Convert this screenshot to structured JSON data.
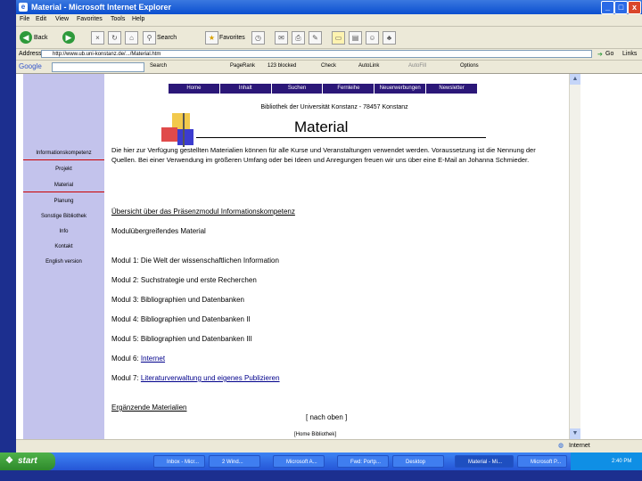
{
  "window": {
    "title": "Material - Microsoft Internet Explorer",
    "minimize": "_",
    "maximize": "□",
    "close": "x"
  },
  "menu": [
    "File",
    "Edit",
    "View",
    "Favorites",
    "Tools",
    "Help"
  ],
  "toolbar": {
    "back": "Back",
    "search": "Search",
    "favorites": "Favorites"
  },
  "address": {
    "label": "Address",
    "url": "http://www.ub.uni-konstanz.de/.../Material.htm",
    "go": "Go",
    "links": "Links"
  },
  "googlebar": {
    "label": "Google",
    "search": "Search",
    "pagerank": "PageRank",
    "blocked": "123 blocked",
    "check": "Check",
    "autolink": "AutoLink",
    "autofill": "AutoFill",
    "options": "Options"
  },
  "sidebar": [
    "Informationskompetenz",
    "Projekt",
    "Material",
    "Planung",
    "Sonstige Bibliothek",
    "Info",
    "Kontakt",
    "English version"
  ],
  "topnav": [
    "Home",
    "Inhalt",
    "Suchen",
    "Fernleihe",
    "Neuerwerbungen",
    "Newsletter"
  ],
  "page": {
    "subtitle": "Bibliothek der Universität Konstanz - 78457 Konstanz",
    "title": "Material",
    "intro": "Die hier zur Verfügung gestellten Materialien können für alle Kurse und Veranstaltungen verwendet werden. Voraussetzung ist die Nennung der Quellen. Bei einer Verwendung im größeren Umfang oder bei Ideen und Anregungen freuen wir uns über eine E-Mail an Johanna Schmieder.",
    "overview_link": "Übersicht über das Präsenzmodul Informationskompetenz",
    "module_heading": "Modulübergreifendes Material",
    "modules": [
      {
        "text": "Modul 1: Die Welt der wissenschaftlichen Information",
        "link": ""
      },
      {
        "text": "Modul 2: Suchstrategie und erste Recherchen",
        "link": ""
      },
      {
        "text": "Modul 3: Bibliographien und Datenbanken",
        "link": ""
      },
      {
        "text": "Modul 4: Bibliographien und Datenbanken II",
        "link": ""
      },
      {
        "text": "Modul 5: Bibliographien und Datenbanken III",
        "link": ""
      },
      {
        "text": "Modul 6: ",
        "link": "Internet"
      },
      {
        "text": "Modul 7: ",
        "link": "Literaturverwaltung und eigenes Publizieren"
      }
    ],
    "supplementary_link": "Ergänzende Materialien",
    "back_to_top": "[ nach oben ]",
    "footer_link": "[Home Bibliothek]"
  },
  "status": {
    "internet": "Internet"
  },
  "taskbar": {
    "start": "start",
    "tasks": [
      "Inbox - Micr...",
      "2 Wind...",
      "Microsoft A...",
      "Fwd: Portp...",
      "Desktop",
      "Material - Mi...",
      "Microsoft P..."
    ],
    "clock": "2:40 PM"
  },
  "colors": {
    "slide_bg": "#1c2f8f",
    "sidebar_bg": "#c3c3ec",
    "nav_bg": "#2b1778",
    "link": "#00008b"
  }
}
